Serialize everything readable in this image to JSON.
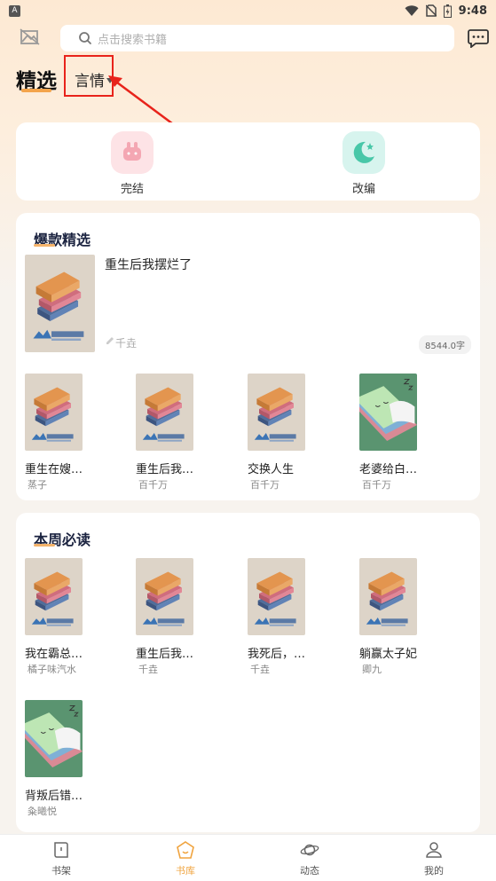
{
  "status_bar": {
    "time": "9:48",
    "notification_icon": "A"
  },
  "search": {
    "placeholder": "点击搜索书籍"
  },
  "tabs": {
    "selected": "精选",
    "category": "言情"
  },
  "quick_categories": [
    {
      "label": "完结",
      "icon": "rabbit-icon"
    },
    {
      "label": "改编",
      "icon": "moon-icon"
    }
  ],
  "hot_section": {
    "title": "爆款精选",
    "featured": {
      "title": "重生后我摆烂了",
      "author": "千垚",
      "word_count": "8544.0字"
    },
    "books": [
      {
        "title": "重生在嫂…",
        "author": "蒸子"
      },
      {
        "title": "重生后我…",
        "author": "百千万"
      },
      {
        "title": "交换人生",
        "author": "百千万"
      },
      {
        "title": "老婆给白…",
        "author": "百千万"
      }
    ]
  },
  "weekly_section": {
    "title": "本周必读",
    "books": [
      {
        "title": "我在霸总…",
        "author": "橘子味汽水"
      },
      {
        "title": "重生后我…",
        "author": "千垚"
      },
      {
        "title": "我死后，…",
        "author": "千垚"
      },
      {
        "title": "躺赢太子妃",
        "author": "卿九"
      },
      {
        "title": "背叛后错…",
        "author": "粂曦悦"
      }
    ]
  },
  "cover_brand": {
    "name": "天河中文网",
    "url": "tianhezw.com"
  },
  "bottom_nav": [
    {
      "label": "书架",
      "icon": "bookshelf-icon"
    },
    {
      "label": "书库",
      "icon": "library-icon",
      "active": true
    },
    {
      "label": "动态",
      "icon": "planet-icon"
    },
    {
      "label": "我的",
      "icon": "profile-icon"
    }
  ],
  "colors": {
    "accent": "#f0a43f",
    "highlight": "#e8231b",
    "title_dark": "#1b2340"
  }
}
